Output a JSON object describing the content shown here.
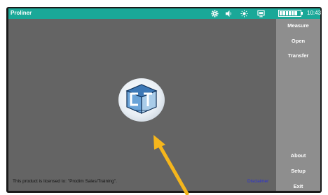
{
  "app": {
    "title": "Proliner"
  },
  "status_bar": {
    "icons": [
      "gear-icon",
      "speaker-icon",
      "brightness-icon",
      "screen-icon"
    ],
    "battery_level": 0.85,
    "time": "10:43"
  },
  "sidebar": {
    "top_items": [
      "Measure",
      "Open",
      "Transfer"
    ],
    "bottom_items": [
      "About",
      "Setup",
      "Exit"
    ]
  },
  "footer": {
    "license_text": "This product is licensed to: \"Prodim Sales/Training\".",
    "disclaimer_link": "Disclaimer"
  },
  "colors": {
    "titlebar": "#1aa898",
    "main_bg": "#646464",
    "sidebar_bg": "#8e8e8e",
    "arrow": "#f5b61c",
    "link": "#2a2fd6"
  }
}
